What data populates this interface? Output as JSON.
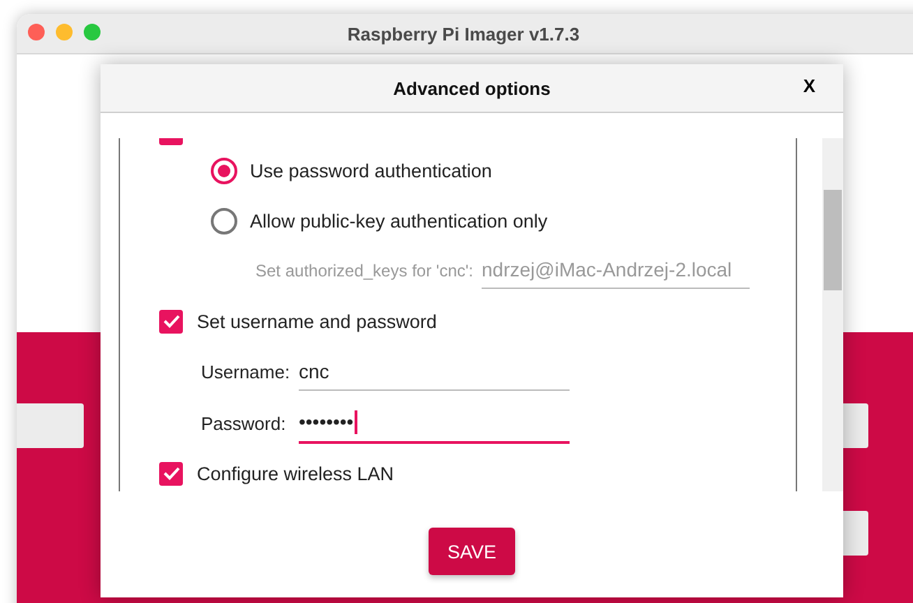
{
  "window": {
    "title": "Raspberry Pi Imager v1.7.3"
  },
  "dialog": {
    "title": "Advanced options",
    "close": "X",
    "auth_options": [
      {
        "label": "Use password authentication",
        "selected": true
      },
      {
        "label": "Allow public-key authentication only",
        "selected": false
      }
    ],
    "authorized_keys": {
      "label": "Set authorized_keys for 'cnc':",
      "value": "ndrzej@iMac-Andrzej-2.local",
      "disabled": true
    },
    "credentials": {
      "label": "Set username and password",
      "checked": true
    },
    "fields": [
      {
        "label": "Username:",
        "value": "cnc",
        "focused": false
      },
      {
        "label": "Password:",
        "value": "••••••••",
        "focused": true
      }
    ],
    "wifi": {
      "label": "Configure wireless LAN",
      "checked": true
    },
    "save": "SAVE"
  }
}
